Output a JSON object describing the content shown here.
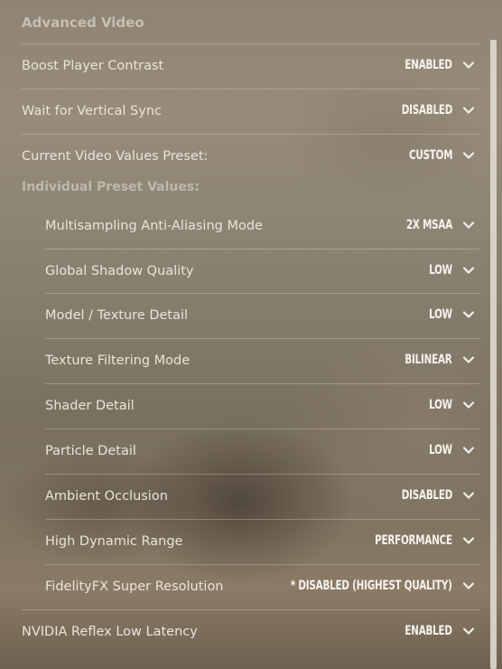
{
  "section_title": "Advanced Video",
  "subsection_title": "Individual Preset Values:",
  "settings": [
    {
      "label": "Boost Player Contrast",
      "value": "ENABLED"
    },
    {
      "label": "Wait for Vertical Sync",
      "value": "DISABLED"
    },
    {
      "label": "Current Video Values Preset:",
      "value": "CUSTOM"
    }
  ],
  "preset_settings": [
    {
      "label": "Multisampling Anti-Aliasing Mode",
      "value": "2X MSAA"
    },
    {
      "label": "Global Shadow Quality",
      "value": "LOW"
    },
    {
      "label": "Model / Texture Detail",
      "value": "LOW"
    },
    {
      "label": "Texture Filtering Mode",
      "value": "BILINEAR"
    },
    {
      "label": "Shader Detail",
      "value": "LOW"
    },
    {
      "label": "Particle Detail",
      "value": "LOW"
    },
    {
      "label": "Ambient Occlusion",
      "value": "DISABLED"
    },
    {
      "label": "High Dynamic Range",
      "value": "PERFORMANCE"
    },
    {
      "label": "FidelityFX Super Resolution",
      "value": "* DISABLED (HIGHEST QUALITY)"
    }
  ],
  "bottom_settings": [
    {
      "label": "NVIDIA Reflex Low Latency",
      "value": "ENABLED"
    }
  ],
  "icons": {
    "dropdown": "chevron-down-icon"
  }
}
